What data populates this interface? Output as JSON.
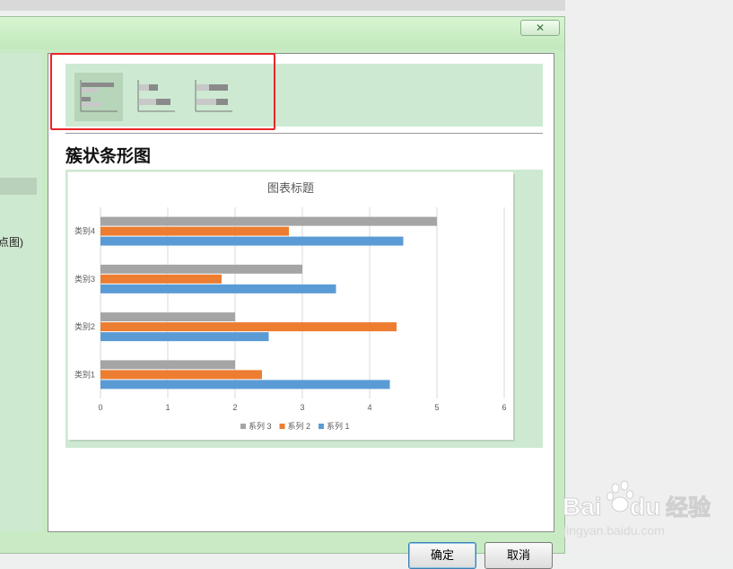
{
  "dialog": {
    "close_glyph": "✕",
    "left_pane_text": "点图)",
    "chart_type_name": "簇状条形图",
    "ok_label": "确定",
    "cancel_label": "取消",
    "subtypes": [
      {
        "name": "clustered-bar",
        "selected": true
      },
      {
        "name": "stacked-bar",
        "selected": false
      },
      {
        "name": "100-percent-stacked-bar",
        "selected": false
      }
    ]
  },
  "watermark": {
    "brand": "Bai",
    "brand2": "du",
    "product": "经验",
    "url": "jingyan.baidu.com"
  },
  "colors": {
    "series1": "#5b9bd5",
    "series2": "#ed7d31",
    "series3": "#a5a5a5",
    "highlight": "#e8262a"
  },
  "chart_data": {
    "type": "bar",
    "orientation": "horizontal",
    "title": "图表标题",
    "categories": [
      "类别1",
      "类别2",
      "类别3",
      "类别4"
    ],
    "series": [
      {
        "name": "系列 1",
        "values": [
          4.3,
          2.5,
          3.5,
          4.5
        ]
      },
      {
        "name": "系列 2",
        "values": [
          2.4,
          4.4,
          1.8,
          2.8
        ]
      },
      {
        "name": "系列 3",
        "values": [
          2,
          2,
          3,
          5
        ]
      }
    ],
    "xlim": [
      0,
      6
    ],
    "x_ticks": [
      "0",
      "1",
      "2",
      "3",
      "4",
      "5",
      "6"
    ],
    "grid": true,
    "legend": "bottom",
    "legend_order": [
      2,
      1,
      0
    ]
  }
}
